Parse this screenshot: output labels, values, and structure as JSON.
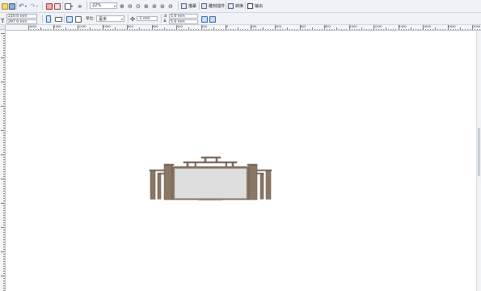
{
  "toolbar_top": {
    "zoom_value": "22%",
    "buttons": [
      {
        "id": "trace",
        "label": "描摹"
      },
      {
        "id": "cutting",
        "label": "雕刻插件"
      },
      {
        "id": "convert",
        "label": "转换"
      },
      {
        "id": "export",
        "label": "输出"
      }
    ]
  },
  "property_bar": {
    "width": "220.0 mm",
    "height": "297.0 mm",
    "units_label": "单位:",
    "units_value": "毫米",
    "nudge": ".1 mm",
    "dup_x": "5.0 mm",
    "dup_y": "5.0 mm"
  },
  "ruler": {
    "labels": [
      "1600",
      "1400",
      "1200",
      "1000",
      "800",
      "600",
      "400",
      "200",
      "0",
      "200",
      "400",
      "600",
      "800",
      "1000",
      "1200",
      "1400",
      "1600",
      "1800",
      "2000",
      "2200"
    ]
  },
  "colors": {
    "toolbar_bg": "#eff2f6",
    "wood_brown": "#8b7765",
    "panel_gray": "#dedede"
  }
}
